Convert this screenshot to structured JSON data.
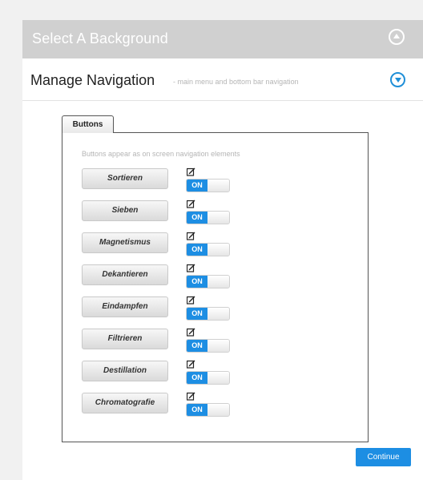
{
  "sections": {
    "background": {
      "title": "Select A Background"
    },
    "navigation": {
      "title": "Manage Navigation",
      "subtitle": "- main menu and bottom bar navigation"
    }
  },
  "tabs": [
    {
      "label": "Buttons"
    }
  ],
  "buttons_panel": {
    "hint": "Buttons appear as on screen navigation elements",
    "items": [
      {
        "label": "Sortieren",
        "toggle": "ON"
      },
      {
        "label": "Sieben",
        "toggle": "ON"
      },
      {
        "label": "Magnetismus",
        "toggle": "ON"
      },
      {
        "label": "Dekantieren",
        "toggle": "ON"
      },
      {
        "label": "Eindampfen",
        "toggle": "ON"
      },
      {
        "label": "Filtrieren",
        "toggle": "ON"
      },
      {
        "label": "Destillation",
        "toggle": "ON"
      },
      {
        "label": "Chromatografie",
        "toggle": "ON"
      }
    ]
  },
  "footer": {
    "continue_label": "Continue"
  },
  "colors": {
    "accent": "#1d8ee3",
    "collapsed_header": "#d0d0d0"
  }
}
